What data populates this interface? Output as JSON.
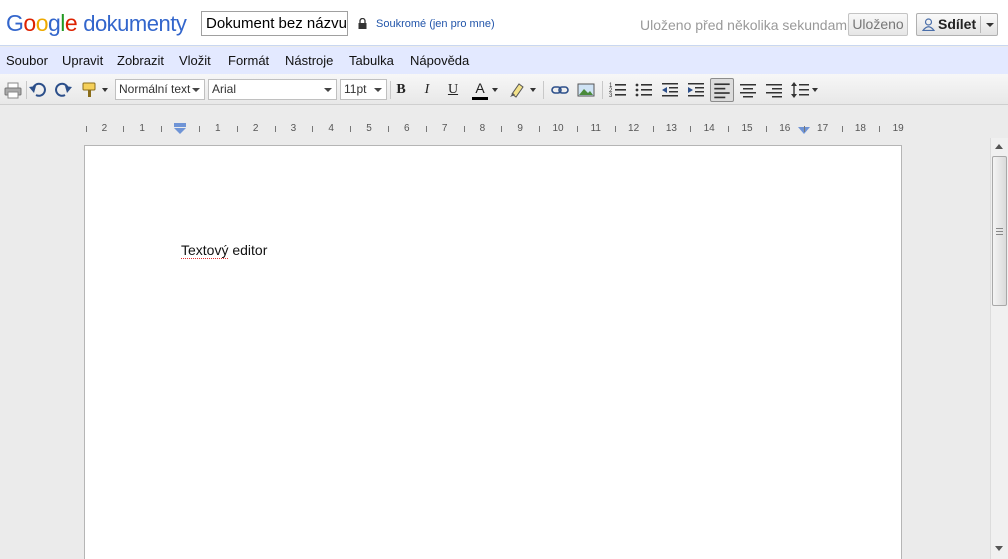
{
  "header": {
    "logo_letters": [
      "G",
      "o",
      "o",
      "g",
      "l",
      "e"
    ],
    "logo_product": "dokumenty",
    "doc_title": "Dokument bez názvu",
    "privacy": "Soukromé (jen pro mne)",
    "saved_status": "Uloženo před několika sekundami",
    "saved_button": "Uloženo",
    "share_button": "Sdílet"
  },
  "menu": {
    "items": [
      "Soubor",
      "Upravit",
      "Zobrazit",
      "Vložit",
      "Formát",
      "Nástroje",
      "Tabulka",
      "Nápověda"
    ]
  },
  "toolbar": {
    "style": "Normální text",
    "font": "Arial",
    "size": "11pt",
    "bold_label": "B",
    "italic_label": "I",
    "underline_label": "U",
    "text_color_label": "A",
    "icons": [
      "print-icon",
      "undo-icon",
      "redo-icon",
      "paint-format-icon",
      "link-icon",
      "image-icon",
      "numbered-list-icon",
      "bulleted-list-icon",
      "decrease-indent-icon",
      "increase-indent-icon",
      "align-left-icon",
      "align-center-icon",
      "align-right-icon",
      "line-spacing-icon"
    ],
    "text_color": "#000000"
  },
  "ruler": {
    "labels": [
      "2",
      "1",
      "1",
      "2",
      "3",
      "4",
      "5",
      "6",
      "7",
      "8",
      "9",
      "10",
      "11",
      "12",
      "13",
      "14",
      "15",
      "16",
      "17",
      "18",
      "19"
    ]
  },
  "document": {
    "text": "Textový editor",
    "spellcheck_word": "Textový"
  },
  "colors": {
    "menubar_bg": "#e3e9ff",
    "accent": "#3366cc"
  }
}
